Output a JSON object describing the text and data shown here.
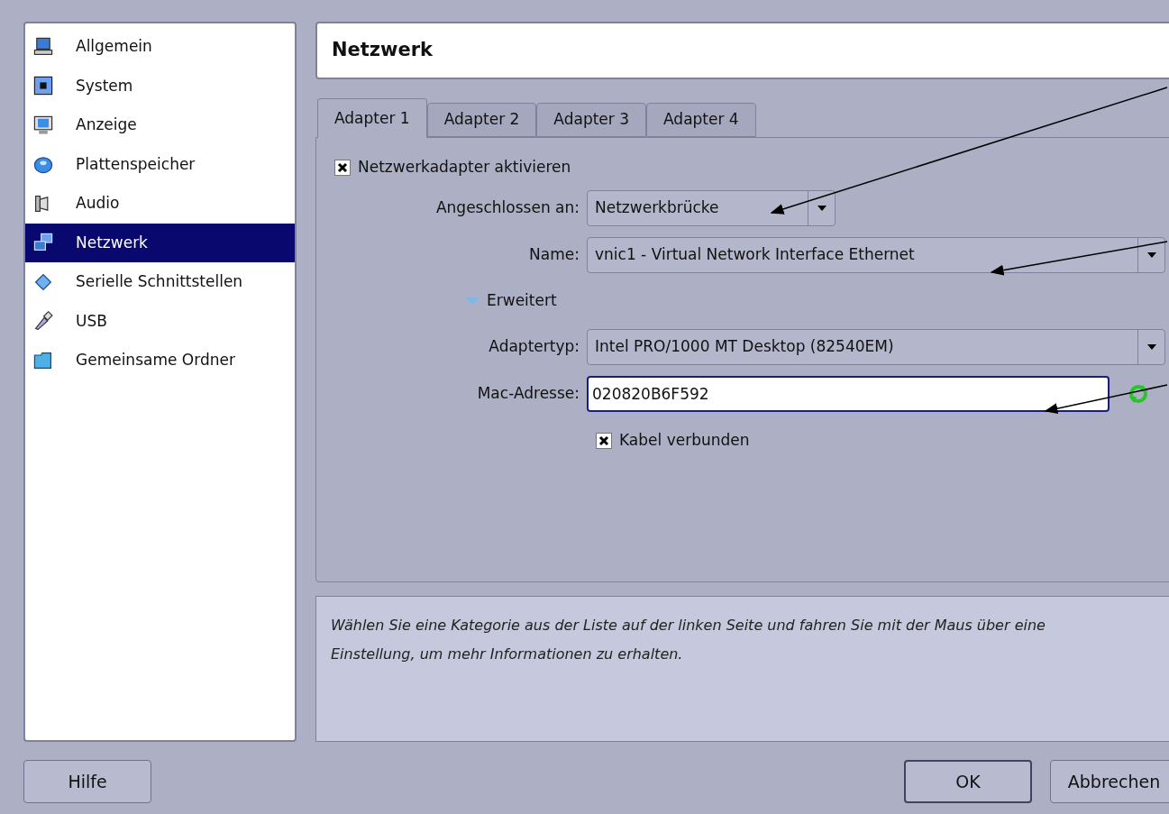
{
  "sidebar": {
    "items": [
      {
        "label": "Allgemein",
        "kind": "computer",
        "selected": false
      },
      {
        "label": "System",
        "kind": "chip",
        "selected": false
      },
      {
        "label": "Anzeige",
        "kind": "monitor",
        "selected": false
      },
      {
        "label": "Plattenspeicher",
        "kind": "disk",
        "selected": false
      },
      {
        "label": "Audio",
        "kind": "speaker",
        "selected": false
      },
      {
        "label": "Netzwerk",
        "kind": "network",
        "selected": true
      },
      {
        "label": "Serielle Schnittstellen",
        "kind": "serial",
        "selected": false
      },
      {
        "label": "USB",
        "kind": "usb",
        "selected": false
      },
      {
        "label": "Gemeinsame Ordner",
        "kind": "folder",
        "selected": false
      }
    ]
  },
  "page_title": "Netzwerk",
  "tabs": [
    {
      "label": "Adapter 1",
      "selected": true
    },
    {
      "label": "Adapter 2",
      "selected": false
    },
    {
      "label": "Adapter 3",
      "selected": false
    },
    {
      "label": "Adapter 4",
      "selected": false
    }
  ],
  "enable_adapter": {
    "label": "Netzwerkadapter aktivieren",
    "checked": true
  },
  "fields": [
    {
      "kind": "combo",
      "label": "Angeschlossen an:",
      "value": "Netzwerkbrücke"
    },
    {
      "kind": "combo",
      "label": "Name:",
      "value": "vnic1 - Virtual Network Interface Ethernet"
    },
    {
      "kind": "expander",
      "label": "Erweitert",
      "expanded": true
    },
    {
      "kind": "combo",
      "label": "Adaptertyp:",
      "value": "Intel PRO/1000 MT Desktop (82540EM)"
    },
    {
      "kind": "text",
      "label": "Mac-Adresse:",
      "value": "020820B6F592"
    },
    {
      "kind": "checkbox",
      "label": "Kabel verbunden",
      "checked": true
    }
  ],
  "info_text": "Wählen Sie eine Kategorie aus der Liste auf der linken Seite und fahren Sie mit der Maus über eine Einstellung, um mehr Informationen zu erhalten.",
  "buttons": {
    "help": "Hilfe",
    "ok": "OK",
    "cancel": "Abbrechen"
  }
}
